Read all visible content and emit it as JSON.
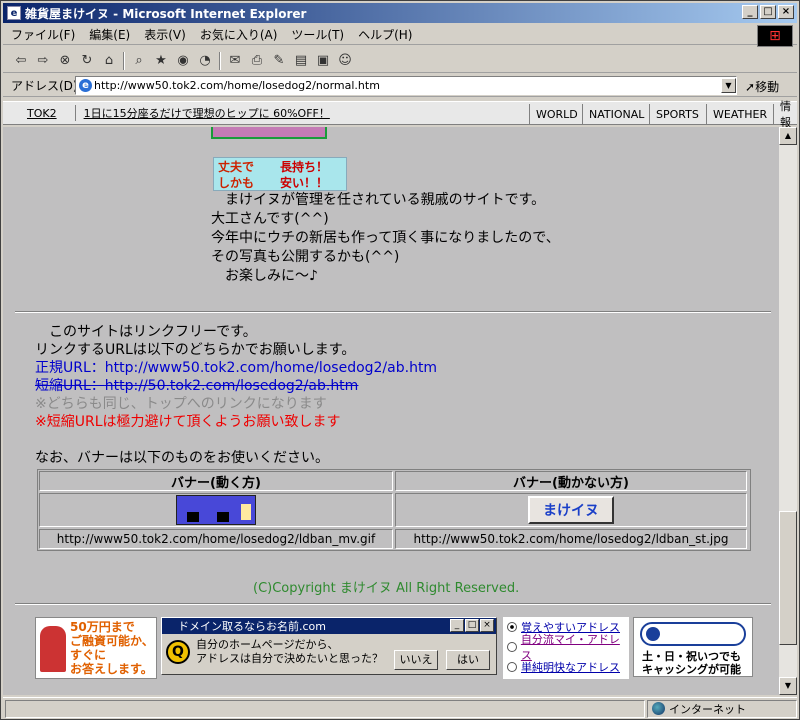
{
  "window": {
    "title": "雑貨屋まけイヌ - Microsoft Internet Explorer"
  },
  "menu": [
    "ファイル(F)",
    "編集(E)",
    "表示(V)",
    "お気に入り(A)",
    "ツール(T)",
    "ヘルプ(H)"
  ],
  "address": {
    "label": "アドレス(D)",
    "url": "http://www50.tok2.com/home/losedog2/normal.htm",
    "go": "移動"
  },
  "links_bar": {
    "tok2": "TOK2",
    "ad": "1日に15分座るだけで理想のヒップに 60%OFF！",
    "nav": [
      "WORLD",
      "NATIONAL",
      "SPORTS",
      "WEATHER",
      "情報"
    ]
  },
  "banner_strong": {
    "line1a": "丈夫で",
    "line1b": "長持ち！",
    "line2a": "しかも",
    "line2b": "安い！！"
  },
  "intro": [
    "　まけイヌが管理を任されている親戚のサイトです。",
    "大工さんです(^^)",
    "今年中にウチの新居も作って頂く事になりましたので、",
    "その写真も公開するかも(^^)",
    "　お楽しみに～♪"
  ],
  "link_section": {
    "line1": "　このサイトはリンクフリーです。",
    "line2": "リンクするURLは以下のどちらかでお願いします。",
    "official_label": "正規URL：",
    "official_url": "http://www50.tok2.com/home/losedog2/ab.htm",
    "short_label": "短縮URL：",
    "short_url": "http://50.tok2.com/losedog2/ab.htm",
    "note_gray": "※どちらも同じ、トップへのリンクになります",
    "note_red": "※短縮URLは極力避けて頂くようお願い致します",
    "banner_intro": "なお、バナーは以下のものをお使いください。"
  },
  "banner_table": {
    "h1": "バナー(動く方)",
    "h2": "バナー(動かない方)",
    "img2_text": "まけイヌ",
    "url1": "http://www50.tok2.com/home/losedog2/ldban_mv.gif",
    "url2": "http://www50.tok2.com/home/losedog2/ldban_st.jpg"
  },
  "copyright": "(C)Copyright まけイヌ All Right Reserved.",
  "ads": {
    "loan_line1": "50万円まで",
    "loan_line2": "ご融資可能か、",
    "loan_line3": "すぐに",
    "loan_line4": "お答えします。",
    "domain_title": "ドメイン取るならお名前.com",
    "domain_text1": "自分のホームページだから、",
    "domain_text2": "アドレスは自分で決めたいと思った？",
    "btn_no": "いいえ",
    "btn_yes": "はい",
    "radio1": "覚えやすいアドレス",
    "radio2": "自分流マイ・アドレス",
    "radio3": "単純明快なアドレス",
    "cash_line1": "土・日・祝いつでも",
    "cash_line2": "キャッシングが可能"
  },
  "status": {
    "zone": "インターネット"
  }
}
